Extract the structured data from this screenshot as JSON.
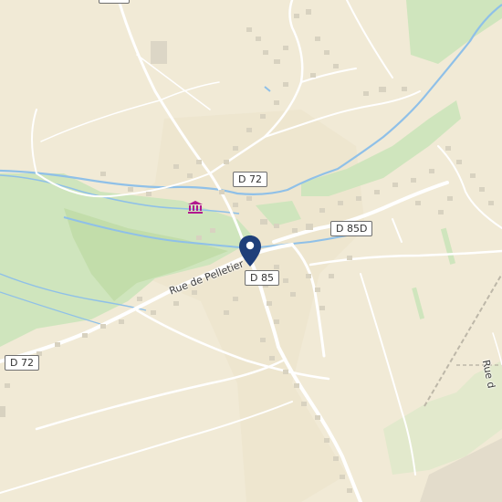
{
  "map": {
    "road_labels": {
      "d72_top": "D 72",
      "d72_left": "D 72",
      "d85": "D 85",
      "d85d": "D 85D"
    },
    "street_labels": {
      "rue_de_pelletier": "Rue de Pelletier",
      "rue_partial": "Rue d"
    },
    "colors": {
      "land": "#f1ead6",
      "meadow": "#cfe5bd",
      "water": "#8fc0e8",
      "road": "#ffffff",
      "building": "#d8d2c0",
      "marker": "#1f3f7a",
      "museum": "#b1198f"
    },
    "icons": {
      "marker": "map-pin-icon",
      "museum": "museum-icon"
    }
  }
}
